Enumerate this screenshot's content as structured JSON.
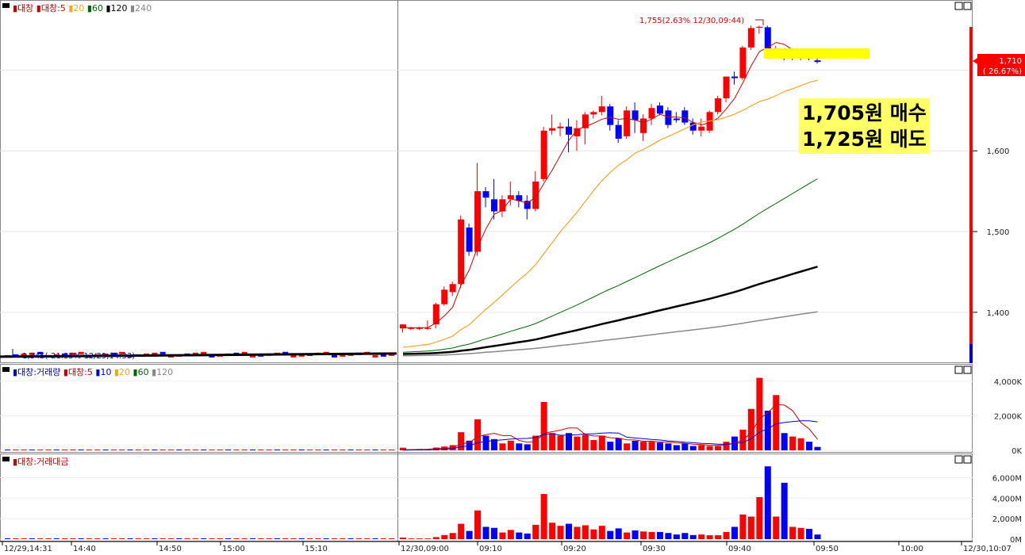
{
  "colors": {
    "up": "#ff0000",
    "down": "#0000ff",
    "ma5": "#cc0000",
    "ma10": "#0000cc",
    "ma20": "#f5a623",
    "ma60": "#006600",
    "ma120": "#000000",
    "ma240": "#888888",
    "highlight": "#ffff00"
  },
  "legends": {
    "price": [
      {
        "text": "대창",
        "color": "#cc0000"
      },
      {
        "text": "대창:5",
        "color": "#cc0000"
      },
      {
        "text": "20",
        "color": "#f5a623"
      },
      {
        "text": "60",
        "color": "#006600"
      },
      {
        "text": "120",
        "color": "#000000"
      },
      {
        "text": "240",
        "color": "#888888"
      }
    ],
    "volume": [
      {
        "text": "대창:거래량",
        "color": "#0000cc"
      },
      {
        "text": "대창:5",
        "color": "#cc0000"
      },
      {
        "text": "10",
        "color": "#0000cc"
      },
      {
        "text": "20",
        "color": "#f5a623"
      },
      {
        "text": "60",
        "color": "#006600"
      },
      {
        "text": "120",
        "color": "#888888"
      }
    ],
    "amount": [
      {
        "text": "대창:거래대금",
        "color": "#cc0000"
      }
    ]
  },
  "annotations": {
    "high": "1,755(2.63% 12/30,09:44)",
    "low": "1,345(-21.35% 12/29,14:33)",
    "current_price": "1,710",
    "current_pct": "( 26.67%)"
  },
  "overlay": {
    "line1": "1,705원 매수",
    "line2": "1,725원 매도"
  },
  "chart_data": {
    "type": "candlestick",
    "y_price_ticks": [
      "1,600",
      "1,500",
      "1,400"
    ],
    "y_volume_ticks": [
      "4,000K",
      "2,000K",
      "0K"
    ],
    "y_amount_ticks": [
      "6,000M",
      "4,000M",
      "2,000M",
      "0M"
    ],
    "x_ticks": [
      "12/29,14:31",
      "14:40",
      "14:50",
      "15:00",
      "15:10",
      "12/30,09:00",
      "09:10",
      "09:20",
      "09:30",
      "09:40",
      "09:50",
      "10:00",
      "12/30,10:07"
    ],
    "price_ylim": [
      1340,
      1775
    ],
    "volume_ylim": [
      0,
      4500
    ],
    "amount_ylim": [
      0,
      7500
    ],
    "candles_12_30": [
      {
        "t": "09:00",
        "o": 1380,
        "h": 1385,
        "l": 1375,
        "c": 1385
      },
      {
        "t": "09:01",
        "o": 1380,
        "h": 1382,
        "l": 1378,
        "c": 1380
      },
      {
        "t": "09:02",
        "o": 1380,
        "h": 1382,
        "l": 1378,
        "c": 1380
      },
      {
        "t": "09:03",
        "o": 1380,
        "h": 1390,
        "l": 1378,
        "c": 1380
      },
      {
        "t": "09:04",
        "o": 1385,
        "h": 1412,
        "l": 1380,
        "c": 1410
      },
      {
        "t": "09:05",
        "o": 1410,
        "h": 1432,
        "l": 1408,
        "c": 1428
      },
      {
        "t": "09:06",
        "o": 1425,
        "h": 1438,
        "l": 1420,
        "c": 1435
      },
      {
        "t": "09:07",
        "o": 1435,
        "h": 1520,
        "l": 1430,
        "c": 1515
      },
      {
        "t": "09:08",
        "o": 1505,
        "h": 1510,
        "l": 1470,
        "c": 1475
      },
      {
        "t": "09:09",
        "o": 1475,
        "h": 1585,
        "l": 1470,
        "c": 1550
      },
      {
        "t": "09:10",
        "o": 1550,
        "h": 1555,
        "l": 1530,
        "c": 1542
      },
      {
        "t": "09:11",
        "o": 1540,
        "h": 1565,
        "l": 1515,
        "c": 1525
      },
      {
        "t": "09:12",
        "o": 1525,
        "h": 1545,
        "l": 1518,
        "c": 1540
      },
      {
        "t": "09:13",
        "o": 1540,
        "h": 1562,
        "l": 1532,
        "c": 1545
      },
      {
        "t": "09:14",
        "o": 1545,
        "h": 1550,
        "l": 1530,
        "c": 1538
      },
      {
        "t": "09:15",
        "o": 1538,
        "h": 1545,
        "l": 1515,
        "c": 1528
      },
      {
        "t": "09:16",
        "o": 1528,
        "h": 1575,
        "l": 1525,
        "c": 1562
      },
      {
        "t": "09:17",
        "o": 1565,
        "h": 1630,
        "l": 1562,
        "c": 1625
      },
      {
        "t": "09:18",
        "o": 1625,
        "h": 1645,
        "l": 1620,
        "c": 1628
      },
      {
        "t": "09:19",
        "o": 1628,
        "h": 1635,
        "l": 1618,
        "c": 1630
      },
      {
        "t": "09:20",
        "o": 1630,
        "h": 1640,
        "l": 1598,
        "c": 1620
      },
      {
        "t": "09:21",
        "o": 1618,
        "h": 1638,
        "l": 1600,
        "c": 1628
      },
      {
        "t": "09:22",
        "o": 1628,
        "h": 1648,
        "l": 1608,
        "c": 1645
      },
      {
        "t": "09:23",
        "o": 1645,
        "h": 1650,
        "l": 1640,
        "c": 1648
      },
      {
        "t": "09:24",
        "o": 1648,
        "h": 1668,
        "l": 1644,
        "c": 1655
      },
      {
        "t": "09:25",
        "o": 1655,
        "h": 1658,
        "l": 1625,
        "c": 1632
      },
      {
        "t": "09:26",
        "o": 1632,
        "h": 1638,
        "l": 1610,
        "c": 1615
      },
      {
        "t": "09:27",
        "o": 1618,
        "h": 1655,
        "l": 1615,
        "c": 1650
      },
      {
        "t": "09:28",
        "o": 1650,
        "h": 1660,
        "l": 1622,
        "c": 1638
      },
      {
        "t": "09:29",
        "o": 1622,
        "h": 1645,
        "l": 1612,
        "c": 1640
      },
      {
        "t": "09:30",
        "o": 1640,
        "h": 1658,
        "l": 1632,
        "c": 1653
      },
      {
        "t": "09:31",
        "o": 1656,
        "h": 1660,
        "l": 1644,
        "c": 1646
      },
      {
        "t": "09:32",
        "o": 1650,
        "h": 1654,
        "l": 1628,
        "c": 1632
      },
      {
        "t": "09:33",
        "o": 1640,
        "h": 1648,
        "l": 1635,
        "c": 1638
      },
      {
        "t": "09:34",
        "o": 1650,
        "h": 1654,
        "l": 1632,
        "c": 1635
      },
      {
        "t": "09:35",
        "o": 1635,
        "h": 1640,
        "l": 1620,
        "c": 1625
      },
      {
        "t": "09:36",
        "o": 1625,
        "h": 1640,
        "l": 1618,
        "c": 1630
      },
      {
        "t": "09:37",
        "o": 1625,
        "h": 1650,
        "l": 1622,
        "c": 1648
      },
      {
        "t": "09:38",
        "o": 1648,
        "h": 1668,
        "l": 1645,
        "c": 1665
      },
      {
        "t": "09:39",
        "o": 1665,
        "h": 1692,
        "l": 1660,
        "c": 1692
      },
      {
        "t": "09:40",
        "o": 1692,
        "h": 1698,
        "l": 1682,
        "c": 1690
      },
      {
        "t": "09:41",
        "o": 1690,
        "h": 1730,
        "l": 1688,
        "c": 1728
      },
      {
        "t": "09:42",
        "o": 1728,
        "h": 1755,
        "l": 1725,
        "c": 1752
      },
      {
        "t": "09:43",
        "o": 1752,
        "h": 1755,
        "l": 1745,
        "c": 1753
      },
      {
        "t": "09:44",
        "o": 1753,
        "h": 1755,
        "l": 1715,
        "c": 1718
      },
      {
        "t": "09:45",
        "o": 1718,
        "h": 1730,
        "l": 1715,
        "c": 1720
      },
      {
        "t": "09:46",
        "o": 1718,
        "h": 1722,
        "l": 1712,
        "c": 1716
      },
      {
        "t": "09:47",
        "o": 1716,
        "h": 1725,
        "l": 1712,
        "c": 1718
      },
      {
        "t": "09:48",
        "o": 1718,
        "h": 1725,
        "l": 1712,
        "c": 1718
      },
      {
        "t": "09:49",
        "o": 1718,
        "h": 1722,
        "l": 1712,
        "c": 1715
      },
      {
        "t": "09:50",
        "o": 1712,
        "h": 1716,
        "l": 1708,
        "c": 1710
      }
    ],
    "volume_12_30": [
      150,
      60,
      60,
      60,
      160,
      220,
      300,
      1050,
      560,
      1800,
      850,
      650,
      400,
      560,
      400,
      350,
      850,
      2800,
      1000,
      850,
      1000,
      800,
      900,
      600,
      850,
      500,
      700,
      400,
      550,
      500,
      500,
      450,
      400,
      300,
      400,
      250,
      300,
      250,
      250,
      500,
      800,
      1200,
      2400,
      4200,
      2300,
      3200,
      1000,
      800,
      700,
      500,
      200
    ],
    "amount_12_30": [
      150,
      70,
      70,
      70,
      200,
      400,
      600,
      1500,
      800,
      2800,
      1200,
      1100,
      650,
      900,
      650,
      550,
      1400,
      4400,
      1600,
      1300,
      1500,
      1200,
      1350,
      950,
      1300,
      800,
      1050,
      650,
      850,
      750,
      700,
      700,
      600,
      450,
      600,
      400,
      450,
      380,
      380,
      700,
      1200,
      2400,
      2200,
      4100,
      7100,
      2200,
      5500,
      1200,
      1100,
      1000,
      450
    ]
  }
}
